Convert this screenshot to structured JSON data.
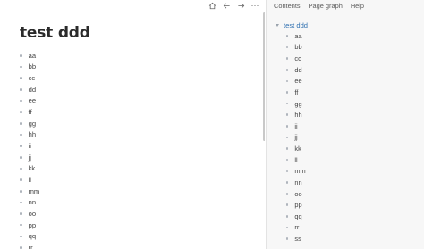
{
  "toolbar": {
    "icons": [
      "home-icon",
      "arrow-left-icon",
      "arrow-right-icon",
      "more-icon"
    ],
    "more_label": "···"
  },
  "page": {
    "title": "test ddd",
    "items": [
      "aa",
      "bb",
      "cc",
      "dd",
      "ee",
      "ff",
      "gg",
      "hh",
      "ii",
      "jj",
      "kk",
      "ll",
      "mm",
      "nn",
      "oo",
      "pp",
      "qq",
      "rr"
    ]
  },
  "sidebar": {
    "tabs": [
      "Contents",
      "Page graph",
      "Help"
    ],
    "active_tab": "Contents",
    "outline_title": "test ddd",
    "outline_items": [
      "aa",
      "bb",
      "cc",
      "dd",
      "ee",
      "ff",
      "gg",
      "hh",
      "ii",
      "jj",
      "kk",
      "ll",
      "mm",
      "nn",
      "oo",
      "pp",
      "qq",
      "rr",
      "ss"
    ]
  },
  "colors": {
    "link": "#2e6fb0",
    "bullet": "#aeb4bc",
    "sidebar_bg": "#f7f7f7"
  }
}
